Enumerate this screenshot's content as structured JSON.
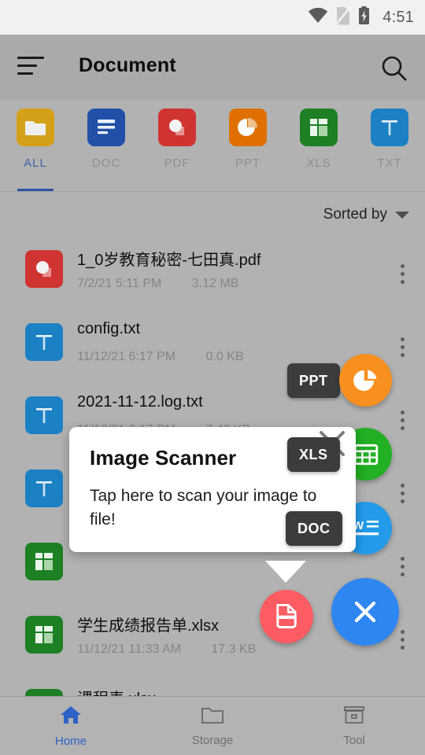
{
  "status_bar": {
    "time": "4:51",
    "icons": [
      "wifi-icon",
      "sim-off-icon",
      "battery-charging-icon"
    ]
  },
  "appbar": {
    "title": "Document",
    "menu_icon": "sort-menu-icon",
    "search_icon": "search-icon"
  },
  "tabs": [
    {
      "label": "ALL",
      "icon": "folder-icon",
      "color": "#d4a017",
      "active": true
    },
    {
      "label": "DOC",
      "icon": "word-doc-icon",
      "color": "#2250a8",
      "active": false
    },
    {
      "label": "PDF",
      "icon": "pdf-icon",
      "color": "#cf3433",
      "active": false
    },
    {
      "label": "PPT",
      "icon": "powerpoint-icon",
      "color": "#df7000",
      "active": false
    },
    {
      "label": "XLS",
      "icon": "excel-icon",
      "color": "#1d8024",
      "active": false
    },
    {
      "label": "TXT",
      "icon": "text-icon",
      "color": "#1c81c4",
      "active": false
    }
  ],
  "list": {
    "sort_label": "Sorted by",
    "sort_caret": "chevron-down-icon",
    "files": [
      {
        "name": "1_0岁教育秘密-七田真.pdf",
        "date": "7/2/21 5:11 PM",
        "size": "3.12 MB",
        "type": "pdf",
        "color": "#cf3433"
      },
      {
        "name": "config.txt",
        "date": "11/12/21 6:17 PM",
        "size": "0.0 KB",
        "type": "txt",
        "color": "#1c81c4"
      },
      {
        "name": "2021-11-12.log.txt",
        "date": "11/12/21 6:17 PM",
        "size": "7.40 KB",
        "type": "txt",
        "color": "#1c81c4"
      },
      {
        "name": "",
        "date": "",
        "size": "",
        "type": "txt",
        "color": "#1c81c4"
      },
      {
        "name": "",
        "date": "",
        "size": "",
        "type": "xls",
        "color": "#1d8024"
      },
      {
        "name": "学生成绩报告单.xlsx",
        "date": "11/12/21 11:33 AM",
        "size": "17.3 KB",
        "type": "xls",
        "color": "#1d8024"
      },
      {
        "name": "课程表.xlsx",
        "date": "",
        "size": "",
        "type": "xls",
        "color": "#1d8024"
      }
    ]
  },
  "fab": {
    "main": {
      "icon": "close-x-icon",
      "color": "#2e86f0"
    },
    "scanner": {
      "icon": "document-scan-icon",
      "color": "#fc5c62"
    },
    "actions": [
      {
        "label": "PPT",
        "icon": "powerpoint-icon",
        "color": "#f7901e"
      },
      {
        "label": "XLS",
        "icon": "excel-icon",
        "color": "#22b024"
      },
      {
        "label": "DOC",
        "icon": "word-doc-icon",
        "color": "#249bea"
      }
    ]
  },
  "tooltip": {
    "title": "Image Scanner",
    "body": "Tap here to scan your image to file!",
    "close_icon": "close-x-icon"
  },
  "bottom_nav": [
    {
      "label": "Home",
      "icon": "home-icon",
      "active": true
    },
    {
      "label": "Storage",
      "icon": "folder-icon",
      "active": false
    },
    {
      "label": "Tool",
      "icon": "toolbox-icon",
      "active": false
    }
  ]
}
